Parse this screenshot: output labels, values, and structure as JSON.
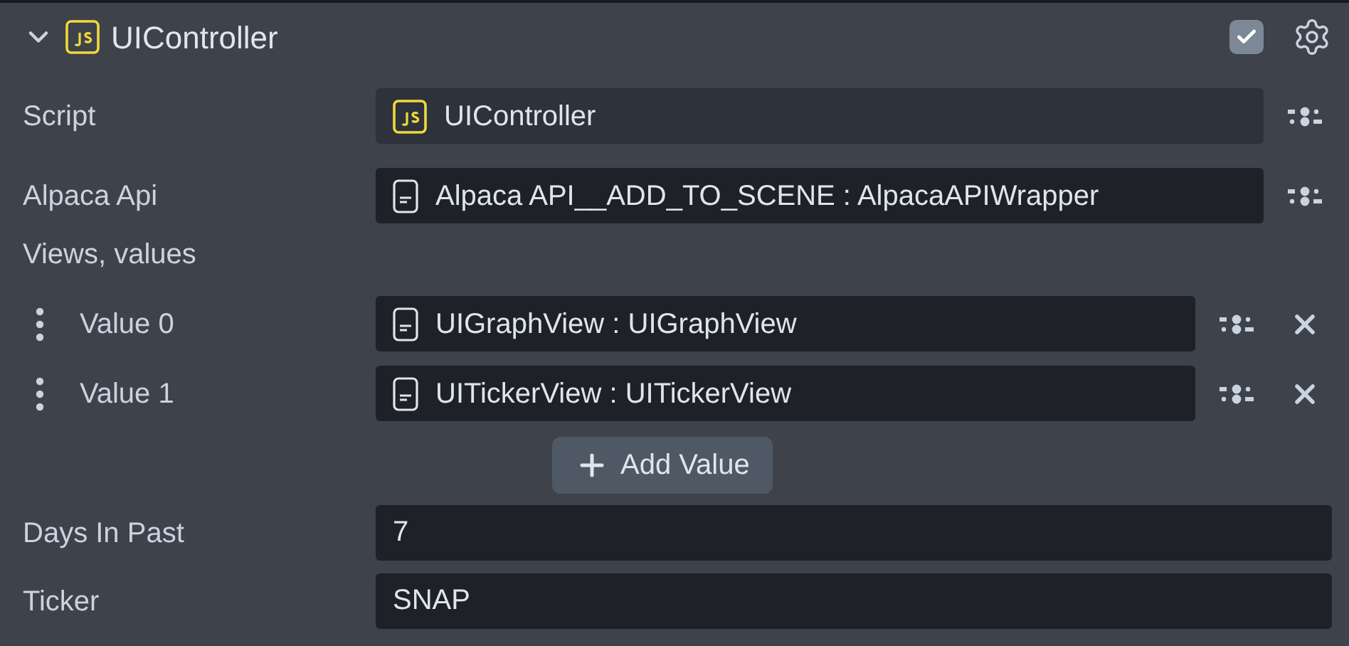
{
  "component": {
    "title": "UIController",
    "expanded": true,
    "enabled": true
  },
  "properties": [
    {
      "kind": "reference",
      "label": "Script",
      "field": {
        "kind": "script",
        "value": "UIController"
      }
    },
    {
      "kind": "reference",
      "label": "Alpaca Api",
      "field": {
        "kind": "object",
        "value": "Alpaca API__ADD_TO_SCENE : AlpacaAPIWrapper"
      }
    },
    {
      "kind": "list",
      "label": "Views, values",
      "items": [
        {
          "label": "Value 0",
          "field": {
            "kind": "object",
            "value": "UIGraphView : UIGraphView"
          }
        },
        {
          "label": "Value 1",
          "field": {
            "kind": "object",
            "value": "UITickerView : UITickerView"
          }
        }
      ],
      "add_button": "Add Value"
    },
    {
      "kind": "text",
      "label": "Days In Past",
      "value": "7"
    },
    {
      "kind": "text",
      "label": "Ticker",
      "value": "SNAP"
    }
  ]
}
